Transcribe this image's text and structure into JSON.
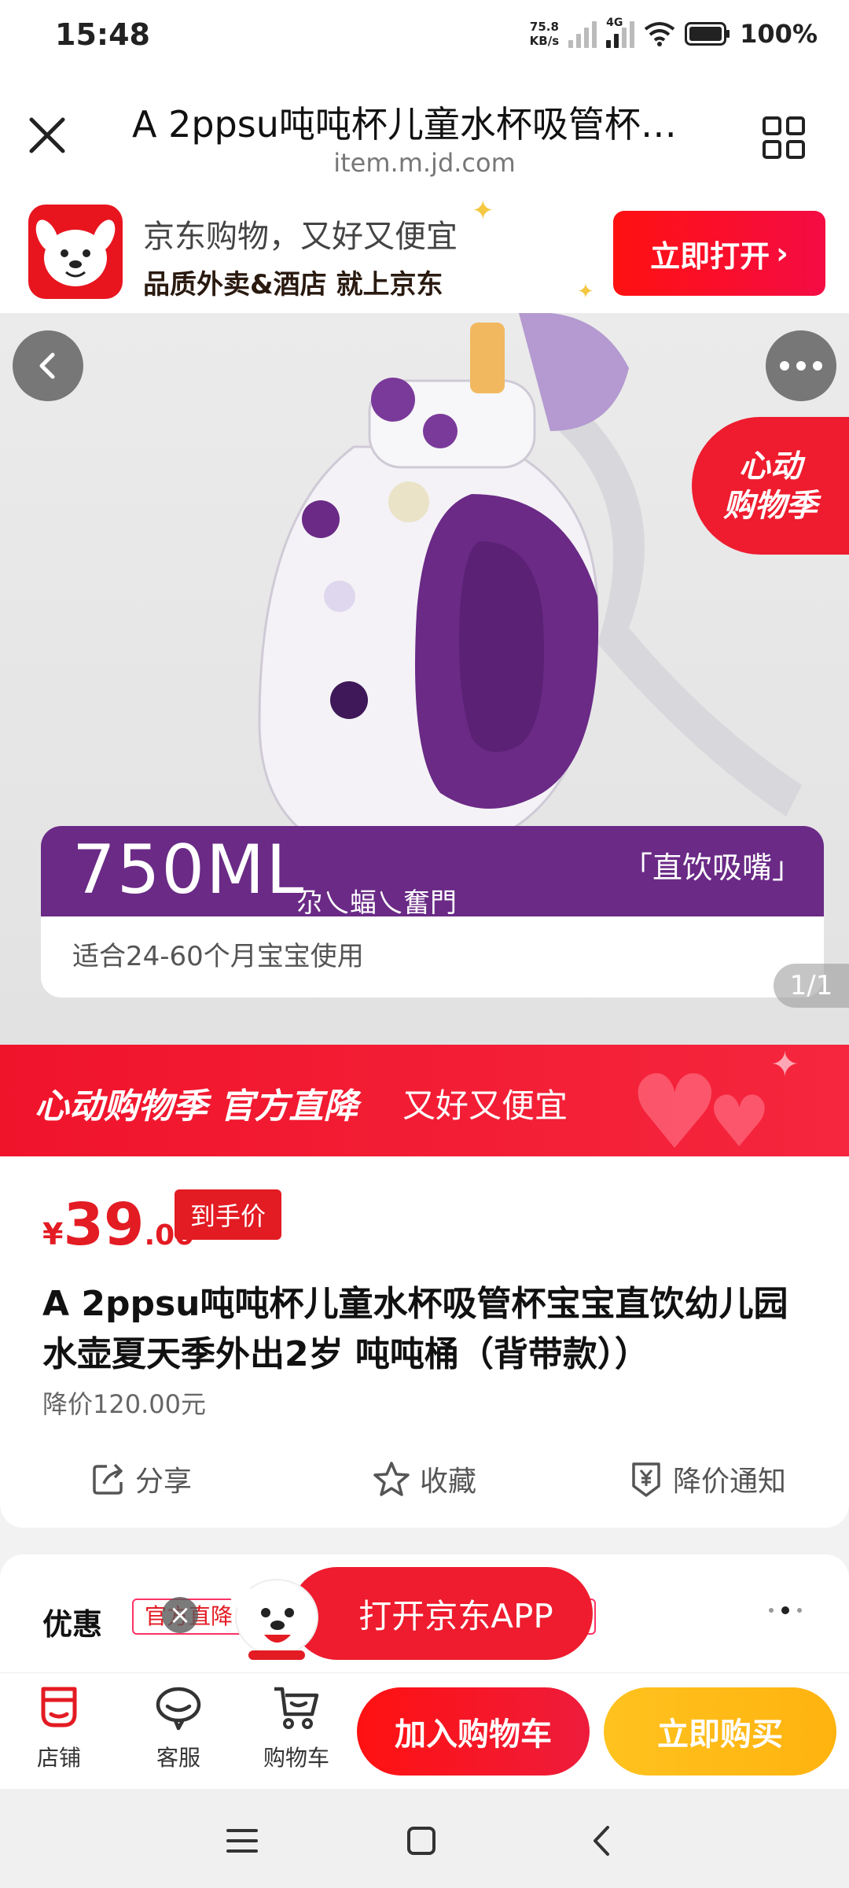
{
  "status_bar": {
    "time": "15:48",
    "speed_value": "75.8",
    "speed_unit": "KB/s",
    "network": "4G",
    "battery": "100%"
  },
  "title_bar": {
    "title": "A 2ppsu吨吨杯儿童水杯吸管杯宝宝直饮幼儿园水壶夏天季外出2岁 吨吨桶（背带款））",
    "url": "item.m.jd.com"
  },
  "promo_banner": {
    "line1": "京东购物，又好又便宜",
    "line2": "品质外卖&酒店 就上京东",
    "open_button": "立即打开"
  },
  "product_image": {
    "season_tag_line1": "心动",
    "season_tag_line2": "购物季",
    "capacity": "750ML",
    "capacity_sub": "尕乀蝠乀奮門",
    "feature": "「直饮吸嘴」",
    "age_note": "适合24-60个月宝宝使用",
    "page_indicator": "1/1"
  },
  "sale_banner": {
    "text_bold": "心动购物季 官方直降",
    "text_regular": "又好又便宜"
  },
  "product_info": {
    "currency": "¥",
    "price_int": "39",
    "price_dec": ".00",
    "price_tag": "到手价",
    "title": "A 2ppsu吨吨杯儿童水杯吸管杯宝宝直饮幼儿园水壶夏天季外出2岁 吨吨桶（背带款））",
    "original_price": "降价120.00元",
    "actions": {
      "share": "分享",
      "favorite": "收藏",
      "price_alert": "降价通知"
    }
  },
  "coupon": {
    "label": "优惠",
    "chip_text": "官方直降",
    "open_app": "打开京东APP"
  },
  "bottom_bar": {
    "store": "店铺",
    "service": "客服",
    "cart": "购物车",
    "add_to_cart": "加入购物车",
    "buy_now": "立即购买"
  },
  "colors": {
    "jd_red": "#e31b23",
    "buy_yellow": "#ffb30f",
    "capacity_purple": "#6a2a86"
  }
}
